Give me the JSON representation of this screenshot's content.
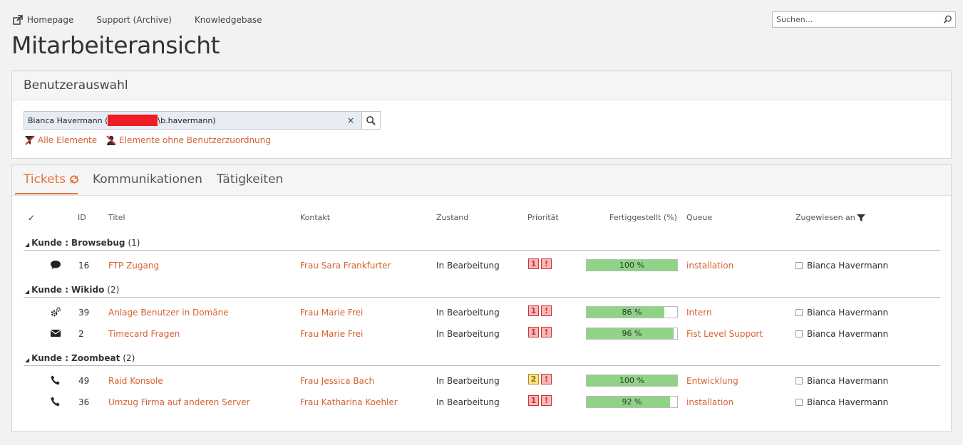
{
  "topnav": {
    "items": [
      {
        "label": "Homepage",
        "icon": "external-link-icon"
      },
      {
        "label": "Support (Archive)"
      },
      {
        "label": "Knowledgebase"
      }
    ]
  },
  "search": {
    "placeholder": "Suchen..."
  },
  "page": {
    "title": "Mitarbeiteransicht"
  },
  "benutzer": {
    "header": "Benutzerauswahl",
    "selected_prefix": "Bianca Havermann (",
    "selected_suffix": "\\b.havermann)",
    "clear": "×",
    "filters": [
      {
        "label": "Alle Elemente",
        "icon": "filter-clear-icon"
      },
      {
        "label": "Elemente ohne Benutzerzuordnung",
        "icon": "user-remove-icon"
      }
    ]
  },
  "tabs": [
    {
      "label": "Tickets",
      "active": true
    },
    {
      "label": "Kommunikationen"
    },
    {
      "label": "Tätigkeiten"
    }
  ],
  "columns": {
    "check": "✓",
    "id": "ID",
    "titel": "Titel",
    "kontakt": "Kontakt",
    "zustand": "Zustand",
    "prioritaet": "Priorität",
    "fertig": "Fertiggestellt (%)",
    "queue": "Queue",
    "zugewiesen": "Zugewiesen an"
  },
  "groups": [
    {
      "label": "Kunde :",
      "name": "Browsebug",
      "count": "(1)",
      "rows": [
        {
          "icon": "chat-icon",
          "id": "16",
          "titel": "FTP Zugang",
          "kontakt": "Frau Sara Frankfurter",
          "zustand": "In Bearbeitung",
          "prio": "1",
          "prio_color": "red",
          "excl": "!",
          "fertig": 100,
          "fertig_label": "100 %",
          "queue": "installation",
          "assignee": "Bianca Havermann"
        }
      ]
    },
    {
      "label": "Kunde :",
      "name": "Wikido",
      "count": "(2)",
      "rows": [
        {
          "icon": "gears-icon",
          "id": "39",
          "titel": "Anlage Benutzer in Domäne",
          "kontakt": "Frau Marie Frei",
          "zustand": "In Bearbeitung",
          "prio": "1",
          "prio_color": "red",
          "excl": "!",
          "fertig": 86,
          "fertig_label": "86 %",
          "queue": "Intern",
          "assignee": "Bianca Havermann"
        },
        {
          "icon": "envelope-icon",
          "id": "2",
          "titel": "Timecard Fragen",
          "kontakt": "Frau Marie Frei",
          "zustand": "In Bearbeitung",
          "prio": "1",
          "prio_color": "red",
          "excl": "!",
          "fertig": 96,
          "fertig_label": "96 %",
          "queue": "Fist Level Support",
          "assignee": "Bianca Havermann"
        }
      ]
    },
    {
      "label": "Kunde :",
      "name": "Zoombeat",
      "count": "(2)",
      "rows": [
        {
          "icon": "phone-icon",
          "id": "49",
          "titel": "Raid Konsole",
          "kontakt": "Frau Jessica Bach",
          "zustand": "In Bearbeitung",
          "prio": "2",
          "prio_color": "yellow",
          "excl": "!",
          "fertig": 100,
          "fertig_label": "100 %",
          "queue": "Entwicklung",
          "assignee": "Bianca Havermann"
        },
        {
          "icon": "phone-icon",
          "id": "36",
          "titel": "Umzug Firma auf anderen Server",
          "kontakt": "Frau Katharina Koehler",
          "zustand": "In Bearbeitung",
          "prio": "1",
          "prio_color": "red",
          "excl": "!",
          "fertig": 92,
          "fertig_label": "92 %",
          "queue": "installation",
          "assignee": "Bianca Havermann"
        }
      ]
    }
  ],
  "colors": {
    "accent": "#e8733b",
    "link": "#d56130",
    "progress": "#8ed484"
  }
}
